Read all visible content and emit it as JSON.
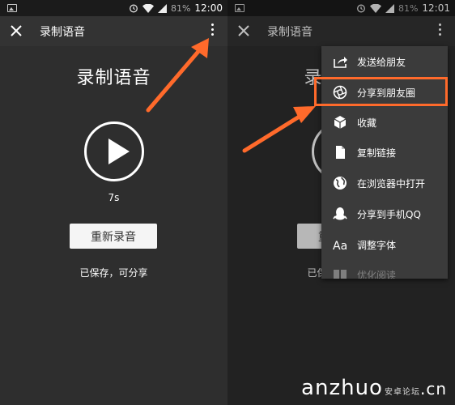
{
  "left": {
    "status": {
      "battery": "81%",
      "time": "12:00"
    },
    "toolbar": {
      "title": "录制语音"
    },
    "content": {
      "heading": "录制语音",
      "duration": "7s",
      "rerecord_label": "重新录音",
      "saved_text": "已保存，可分享"
    }
  },
  "right": {
    "status": {
      "battery": "81%",
      "time": "12:01"
    },
    "toolbar": {
      "title": "录制语音"
    },
    "menu": {
      "items": [
        {
          "label": "发送给朋友",
          "icon": "share-forward-icon"
        },
        {
          "label": "分享到朋友圈",
          "icon": "moments-shutter-icon"
        },
        {
          "label": "收藏",
          "icon": "cube-favorite-icon"
        },
        {
          "label": "复制链接",
          "icon": "document-icon"
        },
        {
          "label": "在浏览器中打开",
          "icon": "globe-icon"
        },
        {
          "label": "分享到手机QQ",
          "icon": "qq-penguin-icon"
        },
        {
          "label": "调整字体",
          "icon": "font-aa-icon"
        },
        {
          "label": "优化阅读",
          "icon": "book-icon"
        }
      ]
    }
  },
  "annotation": {
    "highlight_color": "#ff6a2b"
  },
  "watermark": {
    "brand": "anzhuo",
    "tag": "安卓论坛",
    "suffix": ".cn"
  }
}
